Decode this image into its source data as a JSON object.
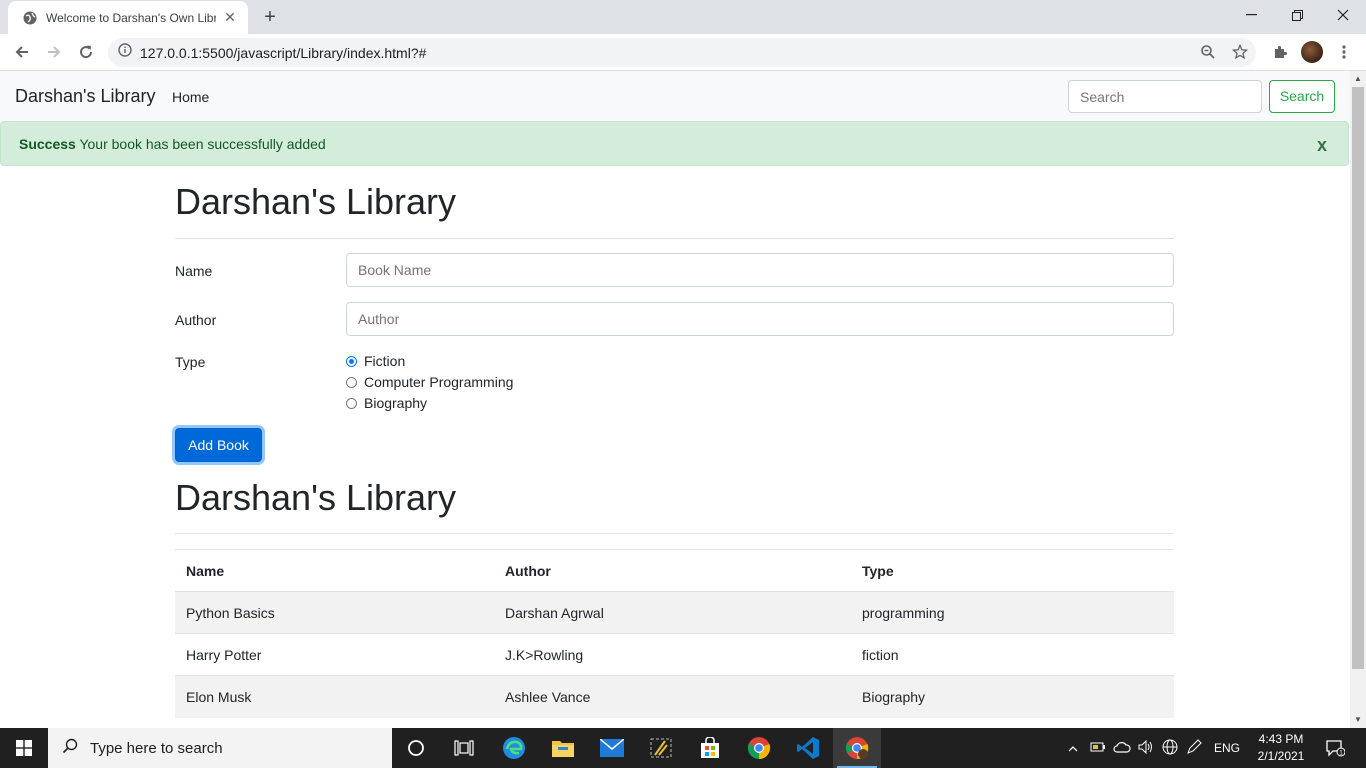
{
  "browser": {
    "tab_title": "Welcome to Darshan's Own Libra",
    "url": "127.0.0.1:5500/javascript/Library/index.html?#"
  },
  "navbar": {
    "brand": "Darshan's Library",
    "home": "Home",
    "search_placeholder": "Search",
    "search_button": "Search"
  },
  "alert": {
    "strong": "Success",
    "message": " Your book has been successfully added",
    "close": "x"
  },
  "form": {
    "heading": "Darshan's Library",
    "name_label": "Name",
    "name_placeholder": "Book Name",
    "author_label": "Author",
    "author_placeholder": "Author",
    "type_label": "Type",
    "types": [
      {
        "label": "Fiction",
        "checked": true
      },
      {
        "label": "Computer Programming",
        "checked": false
      },
      {
        "label": "Biography",
        "checked": false
      }
    ],
    "submit": "Add Book"
  },
  "library": {
    "heading": "Darshan's Library",
    "columns": [
      "Name",
      "Author",
      "Type"
    ],
    "rows": [
      [
        "Python Basics",
        "Darshan Agrwal",
        "programming"
      ],
      [
        "Harry Potter",
        "J.K>Rowling",
        "fiction"
      ],
      [
        "Elon Musk",
        "Ashlee Vance",
        "Biography"
      ]
    ]
  },
  "taskbar": {
    "search_text": "Type here to search",
    "language": "ENG",
    "time": "4:43 PM",
    "date": "2/1/2021",
    "notification_count": "1"
  }
}
